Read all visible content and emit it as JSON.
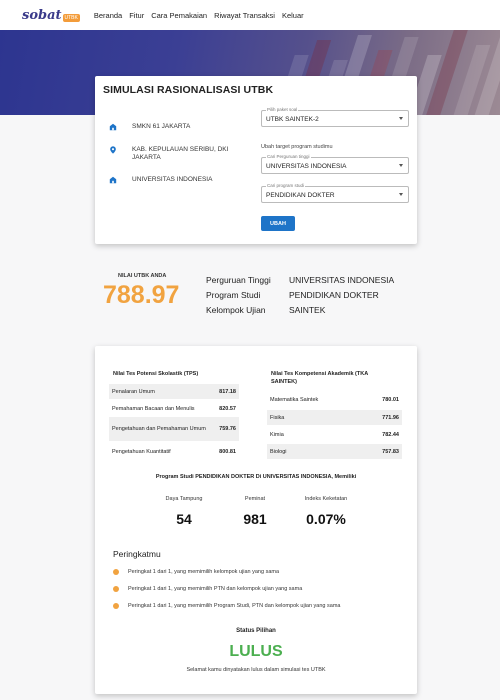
{
  "nav": {
    "logo_text": "sobat",
    "logo_tag": "UTBK",
    "items": [
      "Beranda",
      "Fitur",
      "Cara Pemakaian",
      "Riwayat Transaksi",
      "Keluar"
    ]
  },
  "simulasi": {
    "title": "SIMULASI RASIONALISASI UTBK",
    "school": "SMKN 61 JAKARTA",
    "location": "KAB. KEPULAUAN SERIBU, DKI JAKARTA",
    "university": "UNIVERSITAS INDONESIA",
    "paket": {
      "label": "Pilih paket soal",
      "value": "UTBK SAINTEK-2"
    },
    "ubah_target_text": "Ubah target program studimu",
    "ptn": {
      "label": "Cari Perguruan tinggi",
      "value": "UNIVERSITAS INDONESIA"
    },
    "prodi": {
      "label": "Cari program studi",
      "value": "PENDIDIKAN DOKTER"
    },
    "ubah_button": "UBAH"
  },
  "score": {
    "label": "NILAI UTBK ANDA",
    "value": "788.97",
    "rows": [
      {
        "key": "Perguruan Tinggi",
        "value": "UNIVERSITAS INDONESIA"
      },
      {
        "key": "Program Studi",
        "value": "PENDIDIKAN DOKTER"
      },
      {
        "key": "Kelompok Ujian",
        "value": "SAINTEK"
      }
    ]
  },
  "tps": {
    "title": "Nilai Tes Potensi Skolastik (TPS)",
    "rows": [
      {
        "name": "Penalaran Umum",
        "value": "817.18"
      },
      {
        "name": "Pemahaman Bacaan dan Menulis",
        "value": "820.57"
      },
      {
        "name": "Pengetahuan dan Pemahaman Umum",
        "value": "759.76"
      },
      {
        "name": "Pengetahuan Kuantitatif",
        "value": "800.81"
      }
    ]
  },
  "tka": {
    "title": "Nilai Tes Kompetensi Akademik (TKA SAINTEK)",
    "rows": [
      {
        "name": "Matematika Saintek",
        "value": "780.01"
      },
      {
        "name": "Fisika",
        "value": "771.96"
      },
      {
        "name": "Kimia",
        "value": "782.44"
      },
      {
        "name": "Biologi",
        "value": "757.83"
      }
    ]
  },
  "program": {
    "title": "Program Studi PENDIDIKAN DOKTER Di UNIVERSITAS INDONESIA, Memiliki",
    "stats": [
      {
        "label": "Daya Tampung",
        "value": "54"
      },
      {
        "label": "Peminat",
        "value": "981"
      },
      {
        "label": "Indeks Keketatan",
        "value": "0.07%"
      }
    ]
  },
  "peringkat": {
    "title": "Peringkatmu",
    "items": [
      "Peringkat 1 dari 1, yang memimilih kelompok ujian yang sama",
      "Peringkat 1 dari 1, yang memimilih PTN dan kelompok ujian yang sama",
      "Peringkat 1 dari 1, yang memimilih Program Studi, PTN dan kelompok ujian yang sama"
    ]
  },
  "status": {
    "label": "Status Pilihan",
    "value": "LULUS",
    "note": "Selamat kamu dinyatakan lulus dalam simulasi tes UTBK"
  },
  "colors": {
    "accent_orange": "#f1a340",
    "primary_blue": "#1e74c8",
    "success_green": "#4caf50",
    "hero_indigo": "#2d3590"
  }
}
